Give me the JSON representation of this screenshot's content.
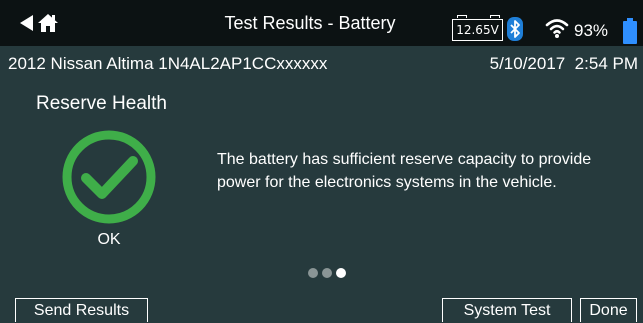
{
  "header": {
    "title": "Test Results - Battery",
    "voltage": "12.65V",
    "battery_percent": "93%",
    "icons": {
      "back": "back-arrow-icon",
      "home": "home-icon",
      "voltage": "vehicle-battery-voltage-icon",
      "bluetooth": "bluetooth-icon",
      "wifi": "wifi-icon",
      "battery": "battery-level-icon"
    }
  },
  "vehicle": {
    "info": "2012 Nissan Altima 1N4AL2AP1CCxxxxxx",
    "datetime": "5/10/2017  2:54 PM"
  },
  "result": {
    "section_title": "Reserve Health",
    "status": "OK",
    "status_icon": "check-circle-icon",
    "description": "The battery has sufficient reserve capacity to provide power for the electronics systems in the vehicle."
  },
  "pager": {
    "total_pages": 3,
    "active_page": 3
  },
  "actions": {
    "send_results": "Send Results",
    "system_test": "System Test",
    "done": "Done"
  },
  "colors": {
    "background": "#263a3d",
    "topbar": "#0c1213",
    "success": "#3fae49",
    "bluetooth": "#1f7fd8",
    "battery_fill": "#2f8fff",
    "text": "#ffffff"
  }
}
